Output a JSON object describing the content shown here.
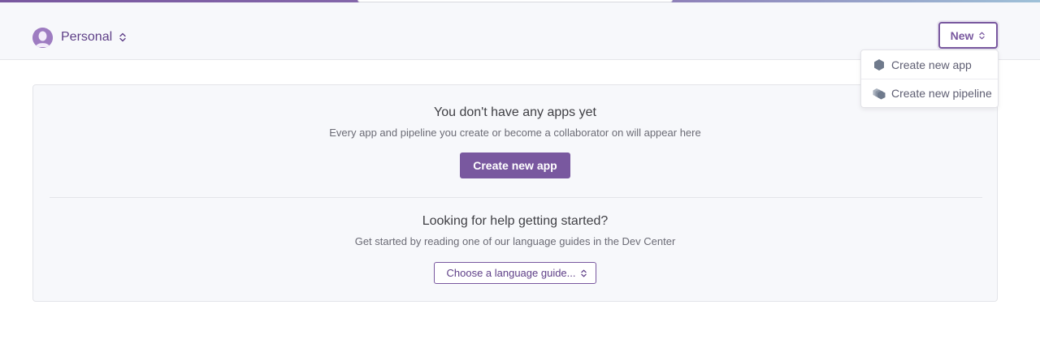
{
  "header": {
    "account_name": "Personal",
    "new_button_label": "New"
  },
  "new_menu": {
    "items": [
      {
        "label": "Create new app",
        "icon": "hexagon-app-icon"
      },
      {
        "label": "Create new pipeline",
        "icon": "pipeline-icon"
      }
    ]
  },
  "empty_state": {
    "heading": "You don't have any apps yet",
    "subtext": "Every app and pipeline you create or become a collaborator on will appear here",
    "create_button_label": "Create new app"
  },
  "help": {
    "heading": "Looking for help getting started?",
    "subtext": "Get started by reading one of our language guides in the Dev Center",
    "select_label": "Choose a language guide..."
  },
  "colors": {
    "accent": "#79589f",
    "accent_dark": "#5e3f87",
    "avatar": "#9e7cc1",
    "panel_bg": "#f7f8fb"
  }
}
